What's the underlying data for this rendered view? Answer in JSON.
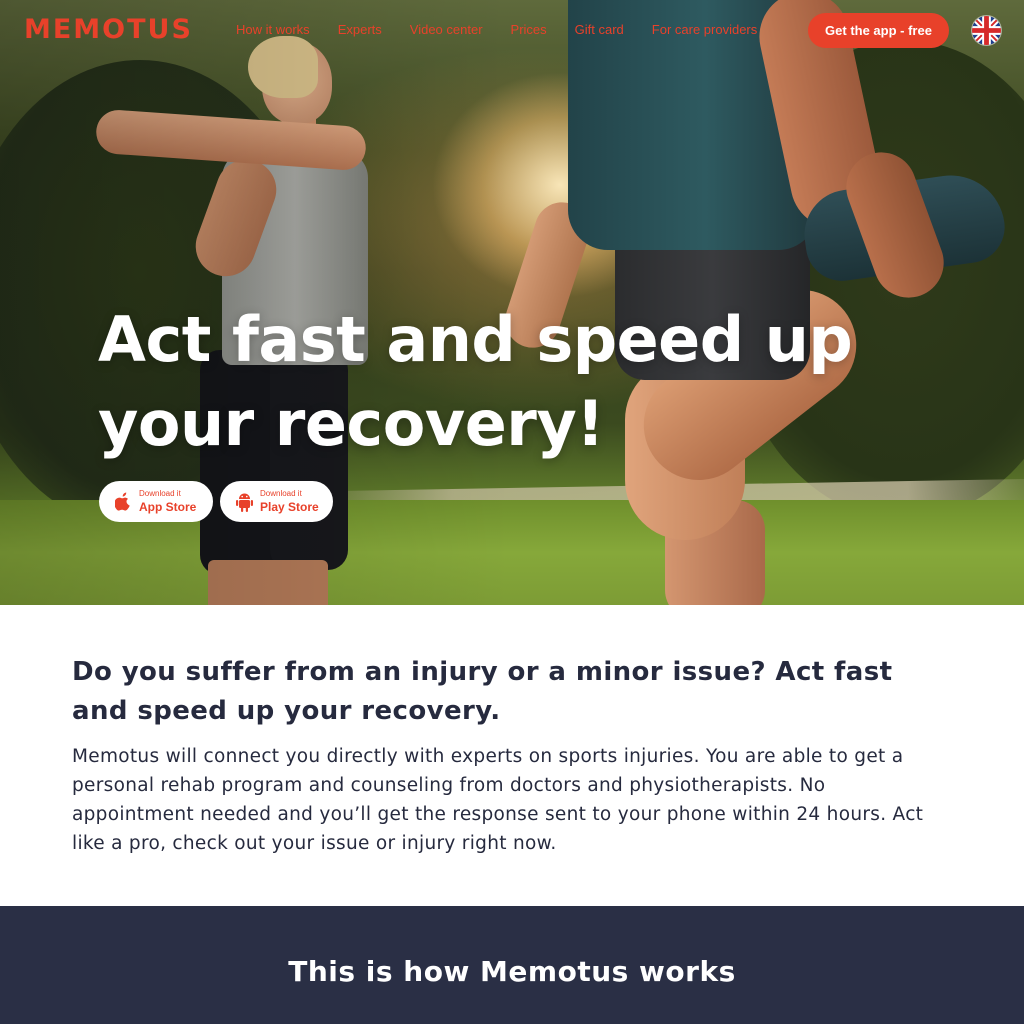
{
  "brand": {
    "logo_text": "MEMOTUS",
    "accent_color": "#e8412a",
    "dark_color": "#2a2f45",
    "text_color": "#262a3e"
  },
  "nav": {
    "links": [
      "How it works",
      "Experts",
      "Video center",
      "Prices",
      "Gift card",
      "For care providers"
    ],
    "cta_label": "Get the app - free",
    "language_icon": "uk-flag-icon"
  },
  "hero": {
    "title_line1": "Act fast and speed up",
    "title_line2": "your recovery!",
    "app_store": {
      "small": "Download it",
      "big": "App Store",
      "icon": "apple-icon"
    },
    "play_store": {
      "small": "Download it",
      "big": "Play Store",
      "icon": "android-icon"
    }
  },
  "intro": {
    "title": "Do you suffer from an injury or a minor issue? Act fast and speed up your recovery.",
    "body": "Memotus will connect you directly with experts on sports injuries. You are able to get a personal rehab program and counseling from doctors and physiotherapists. No appointment needed and you’ll get the response sent to your phone within 24 hours. Act like a pro, check out your issue or injury right now."
  },
  "works": {
    "title": "This is how Memotus works"
  }
}
